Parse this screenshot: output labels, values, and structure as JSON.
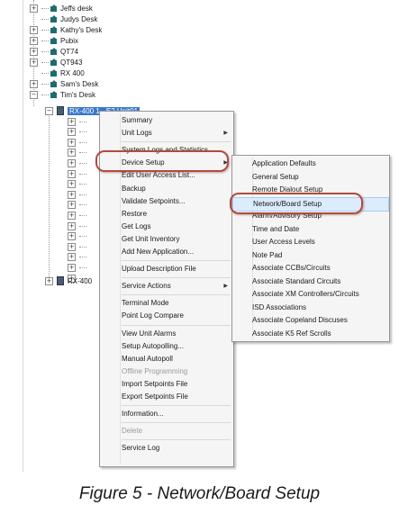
{
  "tree": {
    "sites": [
      {
        "label": "Jeffs desk",
        "expander": "+"
      },
      {
        "label": "Judys Desk",
        "expander": ""
      },
      {
        "label": "Kathy's Desk",
        "expander": "+"
      },
      {
        "label": "Pubix",
        "expander": "+"
      },
      {
        "label": "QT74",
        "expander": "+"
      },
      {
        "label": "QT943",
        "expander": "+"
      },
      {
        "label": "RX 400",
        "expander": ""
      },
      {
        "label": "Sam's Desk",
        "expander": "+"
      },
      {
        "label": "Tim's Desk",
        "expander": "−"
      }
    ],
    "selected_unit": "RX-400 1 - E2 Unit01",
    "other_unit": "RX-400"
  },
  "context_menu": {
    "items": [
      {
        "label": "Summary"
      },
      {
        "label": "Unit Logs",
        "submenu": true
      },
      {
        "sep": true
      },
      {
        "label": "System Logs and Statistics"
      },
      {
        "label": "Device Setup",
        "submenu": true
      },
      {
        "label": "Edit User Access List..."
      },
      {
        "label": "Backup"
      },
      {
        "label": "Validate Setpoints..."
      },
      {
        "label": "Restore"
      },
      {
        "label": "Get Logs"
      },
      {
        "label": "Get Unit Inventory"
      },
      {
        "label": "Add New Application..."
      },
      {
        "sep": true
      },
      {
        "label": "Upload Description File"
      },
      {
        "sep": true
      },
      {
        "label": "Service Actions",
        "submenu": true
      },
      {
        "sep": true
      },
      {
        "label": "Terminal Mode"
      },
      {
        "label": "Point Log Compare"
      },
      {
        "sep": true
      },
      {
        "label": "View Unit Alarms"
      },
      {
        "label": "Setup Autopolling..."
      },
      {
        "label": "Manual Autopoll"
      },
      {
        "label": "Offline Programming",
        "disabled": true
      },
      {
        "label": "Import Setpoints File"
      },
      {
        "label": "Export Setpoints File"
      },
      {
        "sep": true
      },
      {
        "label": "Information..."
      },
      {
        "sep": true
      },
      {
        "label": "Delete",
        "disabled": true
      },
      {
        "sep": true
      },
      {
        "label": "Service Log"
      }
    ]
  },
  "submenu": {
    "items": [
      {
        "label": "Application Defaults"
      },
      {
        "label": "General Setup"
      },
      {
        "label": "Remote Dialout Setup"
      },
      {
        "label": "Network/Board Setup",
        "hover": true
      },
      {
        "label": "Alarm/Advisory Setup"
      },
      {
        "label": "Time and Date"
      },
      {
        "label": "User Access Levels"
      },
      {
        "label": "Note Pad"
      },
      {
        "label": "Associate CCBs/Circuits"
      },
      {
        "label": "Associate Standard Circuits"
      },
      {
        "label": "Associate XM Controllers/Circuits"
      },
      {
        "label": "ISD Associations"
      },
      {
        "label": "Associate Copeland Discuses"
      },
      {
        "label": "Associate K5 Ref Scrolls"
      }
    ]
  },
  "caption": "Figure 5 - Network/Board Setup"
}
